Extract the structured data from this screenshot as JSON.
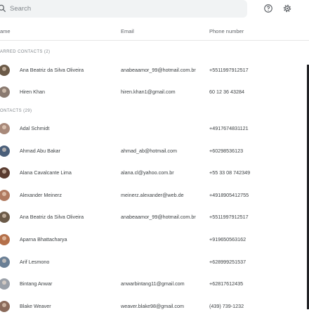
{
  "search": {
    "placeholder": "Search"
  },
  "columns": {
    "name": "ame",
    "email": "Email",
    "phone": "Phone number"
  },
  "sections": {
    "starred": "ARRED CONTACTS (2)",
    "contacts": "ONTACTS (29)"
  },
  "starred": [
    {
      "name": "Ana Beatriz da Silva Oliveira",
      "email": "anabeaamor_99@hotmail.com.br",
      "phone": "+5511997912517",
      "avatar_color": "#6b5a48"
    },
    {
      "name": "Hiren Khan",
      "email": "hiren.khan1@gmail.com",
      "phone": "60 12 36 43284",
      "avatar_color": "#8a7a70"
    }
  ],
  "contacts": [
    {
      "name": "Adal Schmidt",
      "email": "",
      "phone": "+4917674831121",
      "avatar_color": "#a8897a"
    },
    {
      "name": "Ahmad Abu Bakar",
      "email": "ahmad_ab@hotmail.com",
      "phone": "+60298536123",
      "avatar_color": "#4a5f7a"
    },
    {
      "name": "Alana Cavalcante Lima",
      "email": "alana.cl@yahoo.com.br",
      "phone": "+55 33 08 742349",
      "avatar_color": "#5a3c30"
    },
    {
      "name": "Alexander Meinerz",
      "email": "meinerz.alexander@web.de",
      "phone": "+4918905412755",
      "avatar_color": "#b07a60"
    },
    {
      "name": "Ana Beatriz da Silva Oliveira",
      "email": "anabeaamor_99@hotmail.com.br",
      "phone": "+5511997912517",
      "avatar_color": "#6b5a48"
    },
    {
      "name": "Aparna Bhattacharya",
      "email": "",
      "phone": "+919650563162",
      "avatar_color": "#b4704a"
    },
    {
      "name": "Arif Lesmono",
      "email": "",
      "phone": "+628999251537",
      "avatar_color": "#6a7f95"
    },
    {
      "name": "Bintang Anwar",
      "email": "anwarbintang11@gmail.com",
      "phone": "+62817612435",
      "avatar_color": "#9aa0a8"
    },
    {
      "name": "Blake Weaver",
      "email": "weaver.blake98@gmail.com",
      "phone": "(439) 739-1232",
      "avatar_color": "#8a6a5a"
    }
  ]
}
